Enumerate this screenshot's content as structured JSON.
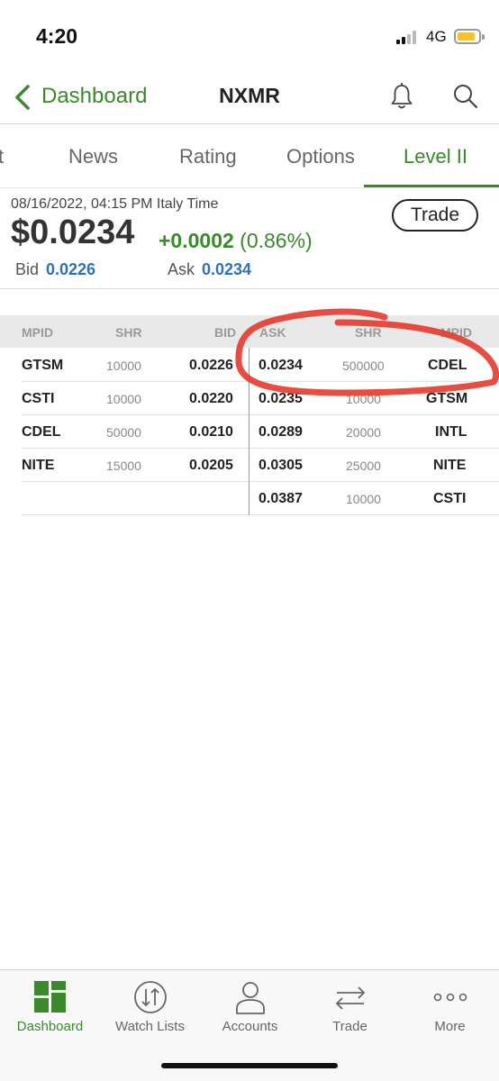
{
  "status_bar": {
    "time": "4:20",
    "network": "4G"
  },
  "nav": {
    "back_label": "Dashboard",
    "title": "NXMR"
  },
  "tabs": [
    {
      "label": "t"
    },
    {
      "label": "News"
    },
    {
      "label": "Rating"
    },
    {
      "label": "Options"
    },
    {
      "label": "Level II",
      "active": true
    }
  ],
  "quote": {
    "timestamp": "08/16/2022, 04:15 PM Italy Time",
    "price": "$0.0234",
    "change": "+0.0002",
    "change_pct": "(0.86%)",
    "trade_label": "Trade",
    "bid_label": "Bid",
    "bid_value": "0.0226",
    "ask_label": "Ask",
    "ask_value": "0.0234"
  },
  "level2": {
    "headers": [
      "MPID",
      "SHR",
      "BID",
      "ASK",
      "SHR",
      "MPID"
    ],
    "bids": [
      {
        "mpid": "GTSM",
        "shr": "10000",
        "price": "0.0226"
      },
      {
        "mpid": "CSTI",
        "shr": "10000",
        "price": "0.0220"
      },
      {
        "mpid": "CDEL",
        "shr": "50000",
        "price": "0.0210"
      },
      {
        "mpid": "NITE",
        "shr": "15000",
        "price": "0.0205"
      }
    ],
    "asks": [
      {
        "price": "0.0234",
        "shr": "500000",
        "mpid": "CDEL"
      },
      {
        "price": "0.0235",
        "shr": "10000",
        "mpid": "GTSM"
      },
      {
        "price": "0.0289",
        "shr": "20000",
        "mpid": "INTL"
      },
      {
        "price": "0.0305",
        "shr": "25000",
        "mpid": "NITE"
      },
      {
        "price": "0.0387",
        "shr": "10000",
        "mpid": "CSTI"
      }
    ]
  },
  "tabbar": [
    {
      "label": "Dashboard",
      "icon": "dashboard-grid-icon",
      "active": true
    },
    {
      "label": "Watch Lists",
      "icon": "up-down-arrows-icon"
    },
    {
      "label": "Accounts",
      "icon": "person-icon"
    },
    {
      "label": "Trade",
      "icon": "swap-arrows-icon"
    },
    {
      "label": "More",
      "icon": "more-dots-icon"
    }
  ],
  "colors": {
    "brand_green": "#3a8a2c",
    "link_blue": "#2d72b8",
    "annotation_red": "#e53a2c"
  }
}
